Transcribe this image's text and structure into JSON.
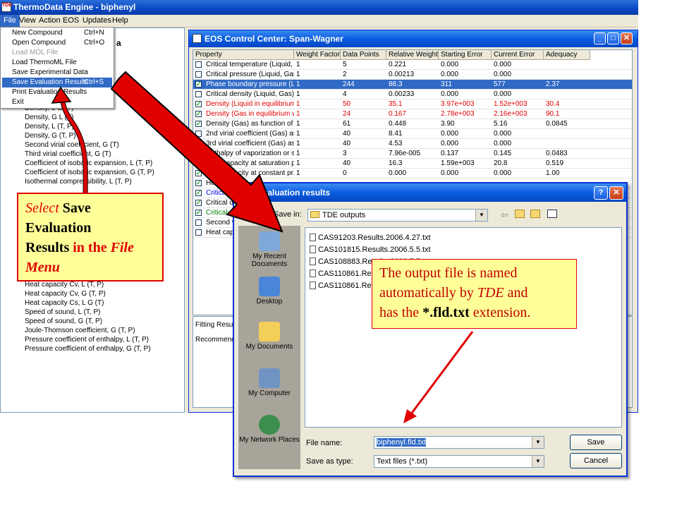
{
  "app": {
    "title": "ThermoData Engine - biphenyl",
    "icon_text": "TDE",
    "menu": [
      "File",
      "View",
      "Action",
      "EOS",
      "Updates",
      "Help"
    ],
    "file_menu": [
      {
        "label": "New Compound",
        "shortcut": "Ctrl+N",
        "state": "normal"
      },
      {
        "label": "Open Compound",
        "shortcut": "Ctrl+O",
        "state": "normal"
      },
      {
        "label": "Load MOL File",
        "shortcut": "",
        "state": "disabled"
      },
      {
        "label": "Load ThermoML File",
        "shortcut": "",
        "state": "normal"
      },
      {
        "label": "Save Experimental Data",
        "shortcut": "",
        "state": "normal"
      },
      {
        "label": "Save Evaluation Results",
        "shortcut": "Ctrl+S",
        "state": "selected"
      },
      {
        "label": "Print Evaluation Results",
        "shortcut": "",
        "state": "normal"
      },
      {
        "label": "Exit",
        "shortcut": "",
        "state": "normal"
      }
    ],
    "tree_heading_fragment": "a",
    "tree_items": [
      "Density, L G (T)",
      "Density, G L (T)",
      "Density, L (T, P)",
      "Density, G (T, P)",
      "Second virial coefficient, G (T)",
      "Third virial coefficient, G (T)",
      "Coefficient of isobaric expansion, L (T, P)",
      "Coefficient of isobaric expansion, G (T, P)",
      "Isothermal compressibility, L (T, P)",
      "Heat capacity Cv, L (T, P)",
      "Heat capacity Cv, G (T, P)",
      "Heat capacity Cs, L G (T)",
      "Speed of sound, L (T, P)",
      "Speed of sound, G (T, P)",
      "Joule-Thomson coefficient, G (T, P)",
      "Pressure coefficient of enthalpy, L (T, P)",
      "Pressure coefficient of enthalpy, G (T, P)"
    ]
  },
  "eos": {
    "title": "EOS Control Center: Span-Wagner",
    "columns": [
      "Property",
      "Weight Factor",
      "Data Points",
      "Relative Weight",
      "Starting Error",
      "Current Error",
      "Adequacy"
    ],
    "rows": [
      {
        "checked": false,
        "style": "normal",
        "cells": [
          "Critical temperature (Liquid, G...",
          "1",
          "5",
          "0.221",
          "0.000",
          "0.000",
          ""
        ]
      },
      {
        "checked": false,
        "style": "normal",
        "cells": [
          "Critical pressure (Liquid, Gas)",
          "1",
          "2",
          "0.00213",
          "0.000",
          "0.000",
          ""
        ]
      },
      {
        "checked": true,
        "style": "sel",
        "cells": [
          "Phase boundary pressure (Li...",
          "1",
          "244",
          "88.3",
          "311",
          "577",
          "2.37"
        ]
      },
      {
        "checked": false,
        "style": "normal",
        "cells": [
          "Critical density (Liquid, Gas)",
          "1",
          "4",
          "0.00233",
          "0.000",
          "0.000",
          ""
        ]
      },
      {
        "checked": true,
        "style": "red",
        "cells": [
          "Density (Liquid in equilibrium ...",
          "1",
          "50",
          "35.1",
          "3.97e+003",
          "1.52e+003",
          "30.4"
        ]
      },
      {
        "checked": true,
        "style": "red",
        "cells": [
          "Density (Gas in equilibrium wit...",
          "1",
          "24",
          "0.167",
          "2.78e+003",
          "2.16e+003",
          "90.1"
        ]
      },
      {
        "checked": true,
        "style": "normal",
        "cells": [
          "Density (Gas) as function of ...",
          "1",
          "61",
          "0.448",
          "3.90",
          "5.16",
          "0.0845"
        ]
      },
      {
        "checked": false,
        "style": "normal",
        "cells": [
          "2nd virial coefficient (Gas) as ...",
          "1",
          "40",
          "8.41",
          "0.000",
          "0.000",
          ""
        ]
      },
      {
        "checked": false,
        "style": "normal",
        "cells": [
          "3rd virial coefficient (Gas) as f...",
          "1",
          "40",
          "4.53",
          "0.000",
          "0.000",
          ""
        ]
      },
      {
        "checked": true,
        "style": "normal",
        "cells": [
          "Enthalpy of vaporization or su...",
          "1",
          "3",
          "7.96e-005",
          "0.137",
          "0.145",
          "0.0483"
        ]
      },
      {
        "checked": true,
        "style": "normal",
        "cells": [
          "Heat capacity at saturation pr...",
          "1",
          "40",
          "16.3",
          "1.59e+003",
          "20.8",
          "0.519"
        ]
      },
      {
        "checked": true,
        "style": "normal",
        "cells": [
          "Heat capacity at constant pr...",
          "1",
          "0",
          "0.000",
          "0.000",
          "0.000",
          "1.00"
        ]
      },
      {
        "checked": true,
        "style": "normal",
        "cells": [
          "Heat c",
          "",
          "",
          "",
          "",
          "",
          ""
        ]
      },
      {
        "checked": true,
        "style": "blue",
        "cells": [
          "Critical te",
          "",
          "",
          "",
          "",
          "",
          ""
        ]
      },
      {
        "checked": true,
        "style": "normal",
        "cells": [
          "Critical de",
          "",
          "",
          "",
          "",
          "",
          ""
        ]
      },
      {
        "checked": true,
        "style": "green",
        "cells": [
          "Critical cu",
          "",
          "",
          "",
          "",
          "",
          ""
        ]
      },
      {
        "checked": false,
        "style": "normal",
        "cells": [
          "Second vi",
          "",
          "",
          "",
          "",
          "",
          ""
        ]
      },
      {
        "checked": false,
        "style": "normal",
        "cells": [
          "Heat cap",
          "",
          "",
          "",
          "",
          "",
          ""
        ]
      }
    ],
    "fitting_label": "Fitting Result:",
    "recommend_label": "Recommenda"
  },
  "dialog": {
    "title": "evaluation results",
    "save_in_label": "Save in:",
    "folder": "TDE outputs",
    "places": [
      "My Recent Documents",
      "Desktop",
      "My Documents",
      "My Computer",
      "My Network Places"
    ],
    "files": [
      "CAS91203.Results.2006.4.27.txt",
      "CAS101815.Results.2006.5.5.txt",
      "CAS108883.Results.2006.5.5.txt",
      "CAS110861.Results",
      "CAS110861.Results"
    ],
    "filename_label": "File name:",
    "filename_value": "biphenyl.fld.txt",
    "savetype_label": "Save as type:",
    "savetype_value": "Text files (*.txt)",
    "save_button": "Save",
    "cancel_button": "Cancel"
  },
  "callout1": {
    "w1": "Select",
    "w2": "Save",
    "w3": "Evaluation",
    "w4": "Results",
    "w5": "in the",
    "w6": "File",
    "w7": "Menu"
  },
  "callout2": {
    "line1": "The output file is named",
    "line2a": "automatically by",
    "line2b": "TDE",
    "line2c": "and",
    "line3a": "has the",
    "line3b": "*.fld.txt",
    "line3c": "extension."
  },
  "colors": {
    "accent": "#316ac5",
    "callout_bg": "#ffff99",
    "arrow": "#e00000"
  }
}
